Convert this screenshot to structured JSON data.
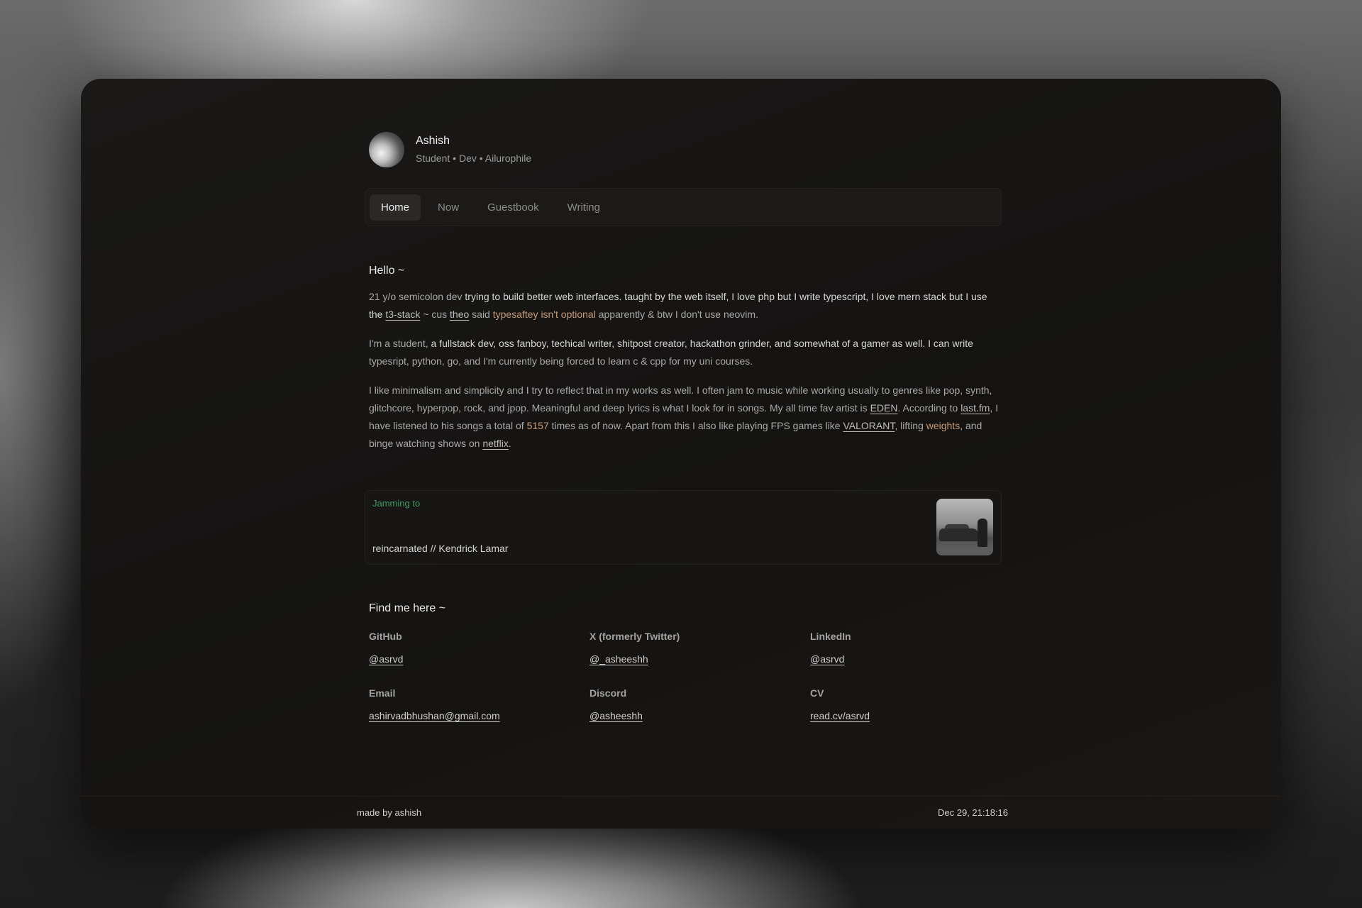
{
  "profile": {
    "name": "Ashish",
    "tagline": "Student • Dev • Ailurophile"
  },
  "nav": {
    "tabs": [
      {
        "label": "Home",
        "active": true
      },
      {
        "label": "Now",
        "active": false
      },
      {
        "label": "Guestbook",
        "active": false
      },
      {
        "label": "Writing",
        "active": false
      }
    ]
  },
  "hello": {
    "heading": "Hello ~",
    "p1": {
      "t1": "21 y/o semicolon dev ",
      "t2": "trying to build better web interfaces. taught by the web itself, I love php but I write typescript, I love mern stack but I use the ",
      "t3_stack": "t3-stack",
      "t4": " ~ cus ",
      "theo": "theo",
      "t5": " said ",
      "typesafety": "typesaftey isn't optional",
      "t6": " apparently & btw I don't use neovim."
    },
    "p2": {
      "t1": "I'm a student, ",
      "t2": "a fullstack dev, oss fanboy, techical writer, shitpost creator, hackathon grinder, and somewhat of a gamer as well. I can write",
      "t3": " typesript, python, go, and I'm currently being forced to learn c & cpp for my uni courses."
    },
    "p3": {
      "t1": "I like minimalism and simplicity and I try to reflect that in my works as well. I often jam to music while working usually to genres like pop, synth, glitchcore, hyperpop, rock, and jpop. Meaningful and deep lyrics is what I look for in songs. My all time fav artist is ",
      "eden": "EDEN",
      "t2": ". According to ",
      "lastfm": "last.fm",
      "t3": ", I have listened to his songs a total of ",
      "count": "5157",
      "t4": " times as of now. Apart from this I also like playing FPS games like ",
      "valorant": "VALORANT",
      "t5": ", lifting ",
      "weights": "weights",
      "t6": ", and binge watching shows on ",
      "netflix": "netflix",
      "t7": "."
    }
  },
  "jamming": {
    "label": "Jamming to",
    "track": "reincarnated // Kendrick Lamar"
  },
  "find": {
    "heading": "Find me here ~",
    "items": [
      {
        "label": "GitHub",
        "value": "@asrvd"
      },
      {
        "label": "X (formerly Twitter)",
        "value": "@_asheeshh"
      },
      {
        "label": "LinkedIn",
        "value": "@asrvd"
      },
      {
        "label": "Email",
        "value": "ashirvadbhushan@gmail.com"
      },
      {
        "label": "Discord",
        "value": "@asheeshh"
      },
      {
        "label": "CV",
        "value": "read.cv/asrvd"
      }
    ]
  },
  "footer": {
    "made_by": "made by ashish",
    "datetime": "Dec 29, 21:18:16"
  },
  "colors": {
    "accent": "#c79b78",
    "jamming_green": "#3f9a63",
    "window_bg": "#141312"
  }
}
